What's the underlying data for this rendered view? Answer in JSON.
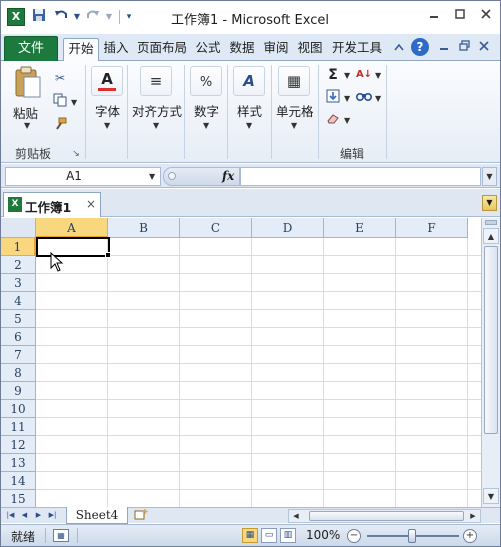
{
  "window": {
    "title": "工作簿1 - Microsoft Excel",
    "app_icon": "X"
  },
  "quick_access": {
    "icons": [
      "save-icon",
      "undo-icon",
      "redo-icon",
      "customize-icon"
    ]
  },
  "window_controls": [
    "minimize-icon",
    "maximize-icon",
    "close-icon"
  ],
  "ribbon_tabs": {
    "file": "文件",
    "tabs": [
      "开始",
      "插入",
      "页面布局",
      "公式",
      "数据",
      "审阅",
      "视图",
      "开发工具"
    ],
    "active": "开始"
  },
  "ribbon": {
    "clipboard": {
      "paste_label": "粘贴",
      "group_label": "剪贴板"
    },
    "font": {
      "label": "字体",
      "icon_glyph": "A"
    },
    "alignment": {
      "label": "对齐方式",
      "icon_glyph": "≡"
    },
    "number": {
      "label": "数字",
      "icon_glyph": "%"
    },
    "styles": {
      "label": "样式",
      "icon_glyph": "A"
    },
    "cells": {
      "label": "单元格",
      "icon_glyph": "▦"
    },
    "editing": {
      "group_label": "编辑",
      "sum_glyph": "Σ",
      "sort_glyph": "A↓",
      "find_glyph": "🔍"
    }
  },
  "formula_bar": {
    "name_box": "A1",
    "fx_label": "fx",
    "formula_value": ""
  },
  "workbook_tab": {
    "title": "工作簿1",
    "close": "×"
  },
  "grid": {
    "columns": [
      "A",
      "B",
      "C",
      "D",
      "E",
      "F"
    ],
    "rows": [
      "1",
      "2",
      "3",
      "4",
      "5",
      "6",
      "7",
      "8",
      "9",
      "10",
      "11",
      "12",
      "13",
      "14",
      "15"
    ],
    "selected_cell": "A1"
  },
  "sheets": {
    "tabs": [
      "Sheet4"
    ],
    "active": "Sheet4"
  },
  "status_bar": {
    "ready": "就绪",
    "zoom": "100%"
  },
  "colors": {
    "file_tab": "#1d7a3e",
    "selection_header": "#f9d77e",
    "ribbon_bg": "#dfe9f5"
  }
}
